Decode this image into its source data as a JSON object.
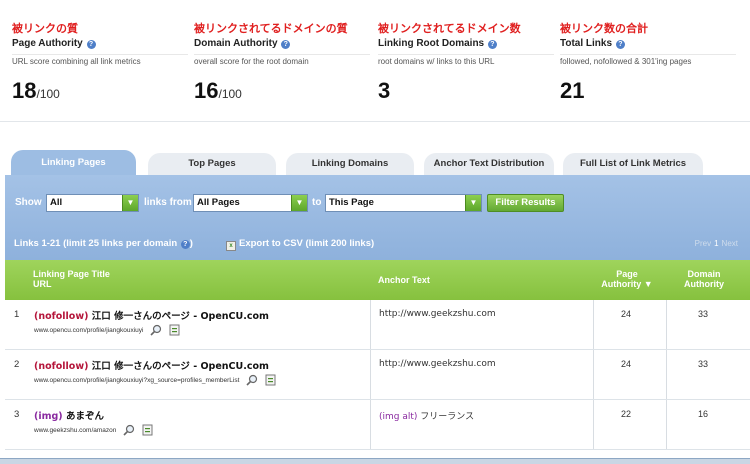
{
  "metrics": [
    {
      "jp": "被リンクの質",
      "title": "Page Authority",
      "desc": "URL score combining all link metrics",
      "value": "18",
      "suffix": "/100"
    },
    {
      "jp": "被リンクされてるドメインの質",
      "title": "Domain Authority",
      "desc": "overall score for the root domain",
      "value": "16",
      "suffix": "/100"
    },
    {
      "jp": "被リンクされてるドメイン数",
      "title": "Linking Root Domains",
      "desc": "root domains w/ links to this URL",
      "value": "3",
      "suffix": ""
    },
    {
      "jp": "被リンク数の合計",
      "title": "Total Links",
      "desc": "followed, nofollowed & 301'ing pages",
      "value": "21",
      "suffix": ""
    }
  ],
  "help_glyph": "?",
  "tabs": [
    {
      "label": "Linking Pages",
      "active": true
    },
    {
      "label": "Top Pages",
      "active": false
    },
    {
      "label": "Linking Domains",
      "active": false
    },
    {
      "label": "Anchor Text Distribution",
      "active": false
    },
    {
      "label": "Full List of Link Metrics",
      "active": false
    }
  ],
  "filter": {
    "show_label": "Show",
    "show_value": "All",
    "links_from_label": "links from",
    "links_from_value": "All Pages",
    "to_label": "to",
    "to_value": "This Page",
    "button_label": "Filter Results"
  },
  "summary": {
    "links_count": "Links 1-21  (limit 25 links per domain",
    "links_count_close": ")",
    "export_label": "Export to CSV (limit 200 links)",
    "pager_prev": "Prev",
    "pager_page": "1",
    "pager_next": "Next"
  },
  "table": {
    "col_title": "Linking Page Title",
    "col_url": "URL",
    "col_anchor": "Anchor Text",
    "col_pa_1": "Page",
    "col_pa_2": "Authority ▼",
    "col_da_1": "Domain",
    "col_da_2": "Authority",
    "rows": [
      {
        "num": "1",
        "tag": "(nofollow)",
        "title": "江口 修一さんのページ - OpenCU.com",
        "url": "www.opencu.com/profile/jiangkouxiuyi",
        "anchor_tag": "",
        "anchor": "http://www.geekzshu.com",
        "pa": "24",
        "da": "33"
      },
      {
        "num": "2",
        "tag": "(nofollow)",
        "title": "江口 修一さんのページ - OpenCU.com",
        "url": "www.opencu.com/profile/jiangkouxiuyi?xg_source=profiles_memberList",
        "anchor_tag": "",
        "anchor": "http://www.geekzshu.com",
        "pa": "24",
        "da": "33"
      },
      {
        "num": "3",
        "tag": "(img)",
        "title": "あまぞん",
        "url": "www.geekzshu.com/amazon",
        "anchor_tag": "(img alt)",
        "anchor": "フリーランス",
        "pa": "22",
        "da": "16"
      }
    ]
  },
  "colors": {
    "red_heading": "#e02020",
    "tab_active": "#9dbde3",
    "panel": "#8eb1dc",
    "table_header": "#8fc84a",
    "nofollow": "#b5163b"
  }
}
